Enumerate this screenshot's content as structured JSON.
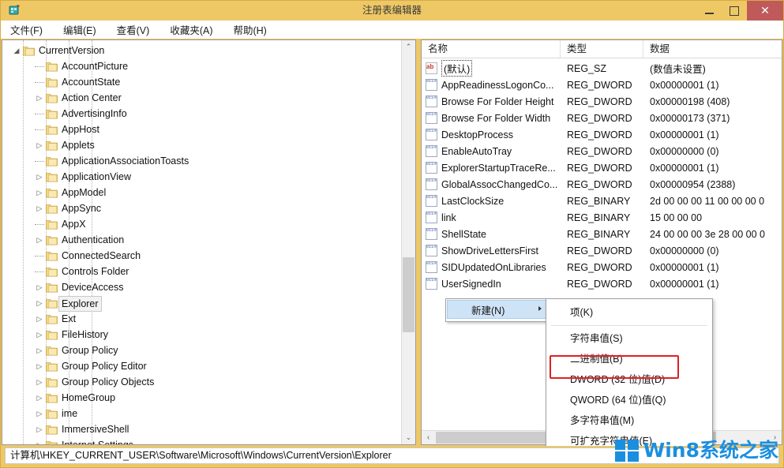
{
  "window": {
    "title": "注册表编辑器",
    "icon": "regedit-icon",
    "minimize_label": "",
    "maximize_label": "",
    "close_label": "✕",
    "titlebar_color": "#efc866",
    "close_color": "#c05a5a"
  },
  "menubar": {
    "items": [
      {
        "label": "文件(F)"
      },
      {
        "label": "编辑(E)"
      },
      {
        "label": "查看(V)"
      },
      {
        "label": "收藏夹(A)"
      },
      {
        "label": "帮助(H)"
      }
    ]
  },
  "tree": {
    "nodes": [
      {
        "label": "CurrentVersion",
        "depth": 4,
        "expander": "expanded",
        "selected": false
      },
      {
        "label": "AccountPicture",
        "depth": 5,
        "expander": "none",
        "selected": false
      },
      {
        "label": "AccountState",
        "depth": 5,
        "expander": "none",
        "selected": false
      },
      {
        "label": "Action Center",
        "depth": 5,
        "expander": "collapsed",
        "selected": false
      },
      {
        "label": "AdvertisingInfo",
        "depth": 5,
        "expander": "none",
        "selected": false
      },
      {
        "label": "AppHost",
        "depth": 5,
        "expander": "none",
        "selected": false
      },
      {
        "label": "Applets",
        "depth": 5,
        "expander": "collapsed",
        "selected": false
      },
      {
        "label": "ApplicationAssociationToasts",
        "depth": 5,
        "expander": "none",
        "selected": false
      },
      {
        "label": "ApplicationView",
        "depth": 5,
        "expander": "collapsed",
        "selected": false
      },
      {
        "label": "AppModel",
        "depth": 5,
        "expander": "collapsed",
        "selected": false
      },
      {
        "label": "AppSync",
        "depth": 5,
        "expander": "collapsed",
        "selected": false
      },
      {
        "label": "AppX",
        "depth": 5,
        "expander": "none",
        "selected": false
      },
      {
        "label": "Authentication",
        "depth": 5,
        "expander": "collapsed",
        "selected": false
      },
      {
        "label": "ConnectedSearch",
        "depth": 5,
        "expander": "none",
        "selected": false
      },
      {
        "label": "Controls Folder",
        "depth": 5,
        "expander": "none",
        "selected": false
      },
      {
        "label": "DeviceAccess",
        "depth": 5,
        "expander": "collapsed",
        "selected": false
      },
      {
        "label": "Explorer",
        "depth": 5,
        "expander": "collapsed",
        "selected": true
      },
      {
        "label": "Ext",
        "depth": 5,
        "expander": "collapsed",
        "selected": false
      },
      {
        "label": "FileHistory",
        "depth": 5,
        "expander": "collapsed",
        "selected": false
      },
      {
        "label": "Group Policy",
        "depth": 5,
        "expander": "collapsed",
        "selected": false
      },
      {
        "label": "Group Policy Editor",
        "depth": 5,
        "expander": "collapsed",
        "selected": false
      },
      {
        "label": "Group Policy Objects",
        "depth": 5,
        "expander": "collapsed",
        "selected": false
      },
      {
        "label": "HomeGroup",
        "depth": 5,
        "expander": "collapsed",
        "selected": false
      },
      {
        "label": "ime",
        "depth": 5,
        "expander": "collapsed",
        "selected": false
      },
      {
        "label": "ImmersiveShell",
        "depth": 5,
        "expander": "collapsed",
        "selected": false
      },
      {
        "label": "Internet Settings",
        "depth": 5,
        "expander": "collapsed",
        "selected": false
      }
    ],
    "scrollbar": {
      "up_arrow": "⌃",
      "down_arrow": "⌄"
    }
  },
  "values": {
    "columns": [
      {
        "key": "name",
        "label": "名称"
      },
      {
        "key": "type",
        "label": "类型"
      },
      {
        "key": "data",
        "label": "数据"
      }
    ],
    "rows": [
      {
        "name": "(默认)",
        "type": "REG_SZ",
        "data": "(数值未设置)",
        "icon": "string-value-icon",
        "selected": true
      },
      {
        "name": "AppReadinessLogonCo...",
        "type": "REG_DWORD",
        "data": "0x00000001 (1)",
        "icon": "binary-value-icon",
        "selected": false
      },
      {
        "name": "Browse For Folder Height",
        "type": "REG_DWORD",
        "data": "0x00000198 (408)",
        "icon": "binary-value-icon",
        "selected": false
      },
      {
        "name": "Browse For Folder Width",
        "type": "REG_DWORD",
        "data": "0x00000173 (371)",
        "icon": "binary-value-icon",
        "selected": false
      },
      {
        "name": "DesktopProcess",
        "type": "REG_DWORD",
        "data": "0x00000001 (1)",
        "icon": "binary-value-icon",
        "selected": false
      },
      {
        "name": "EnableAutoTray",
        "type": "REG_DWORD",
        "data": "0x00000000 (0)",
        "icon": "binary-value-icon",
        "selected": false
      },
      {
        "name": "ExplorerStartupTraceRe...",
        "type": "REG_DWORD",
        "data": "0x00000001 (1)",
        "icon": "binary-value-icon",
        "selected": false
      },
      {
        "name": "GlobalAssocChangedCo...",
        "type": "REG_DWORD",
        "data": "0x00000954 (2388)",
        "icon": "binary-value-icon",
        "selected": false
      },
      {
        "name": "LastClockSize",
        "type": "REG_BINARY",
        "data": "2d 00 00 00 11 00 00 00 0",
        "icon": "binary-value-icon",
        "selected": false
      },
      {
        "name": "link",
        "type": "REG_BINARY",
        "data": "15 00 00 00",
        "icon": "binary-value-icon",
        "selected": false
      },
      {
        "name": "ShellState",
        "type": "REG_BINARY",
        "data": "24 00 00 00 3e 28 00 00 0",
        "icon": "binary-value-icon",
        "selected": false
      },
      {
        "name": "ShowDriveLettersFirst",
        "type": "REG_DWORD",
        "data": "0x00000000 (0)",
        "icon": "binary-value-icon",
        "selected": false
      },
      {
        "name": "SIDUpdatedOnLibraries",
        "type": "REG_DWORD",
        "data": "0x00000001 (1)",
        "icon": "binary-value-icon",
        "selected": false
      },
      {
        "name": "UserSignedIn",
        "type": "REG_DWORD",
        "data": "0x00000001 (1)",
        "icon": "binary-value-icon",
        "selected": false
      }
    ],
    "hscrollbar": {
      "left_arrow": "‹",
      "right_arrow": "›"
    }
  },
  "context_menu": {
    "parent_item": "新建(N)",
    "submenu": [
      {
        "label": "项(K)",
        "highlighted": false,
        "separator_after": true
      },
      {
        "label": "字符串值(S)",
        "highlighted": false,
        "separator_after": false
      },
      {
        "label": "二进制值(B)",
        "highlighted": false,
        "separator_after": false
      },
      {
        "label": "DWORD (32 位)值(D)",
        "highlighted": true,
        "separator_after": false
      },
      {
        "label": "QWORD (64 位)值(Q)",
        "highlighted": false,
        "separator_after": false
      },
      {
        "label": "多字符串值(M)",
        "highlighted": false,
        "separator_after": false
      },
      {
        "label": "可扩充字符串值(E)",
        "highlighted": false,
        "separator_after": false
      }
    ],
    "highlight_color": "#e02020"
  },
  "statusbar": {
    "path": "计算机\\HKEY_CURRENT_USER\\Software\\Microsoft\\Windows\\CurrentVersion\\Explorer"
  },
  "watermark": {
    "text": "Win8系统之家",
    "color": "#1a8fe0"
  }
}
